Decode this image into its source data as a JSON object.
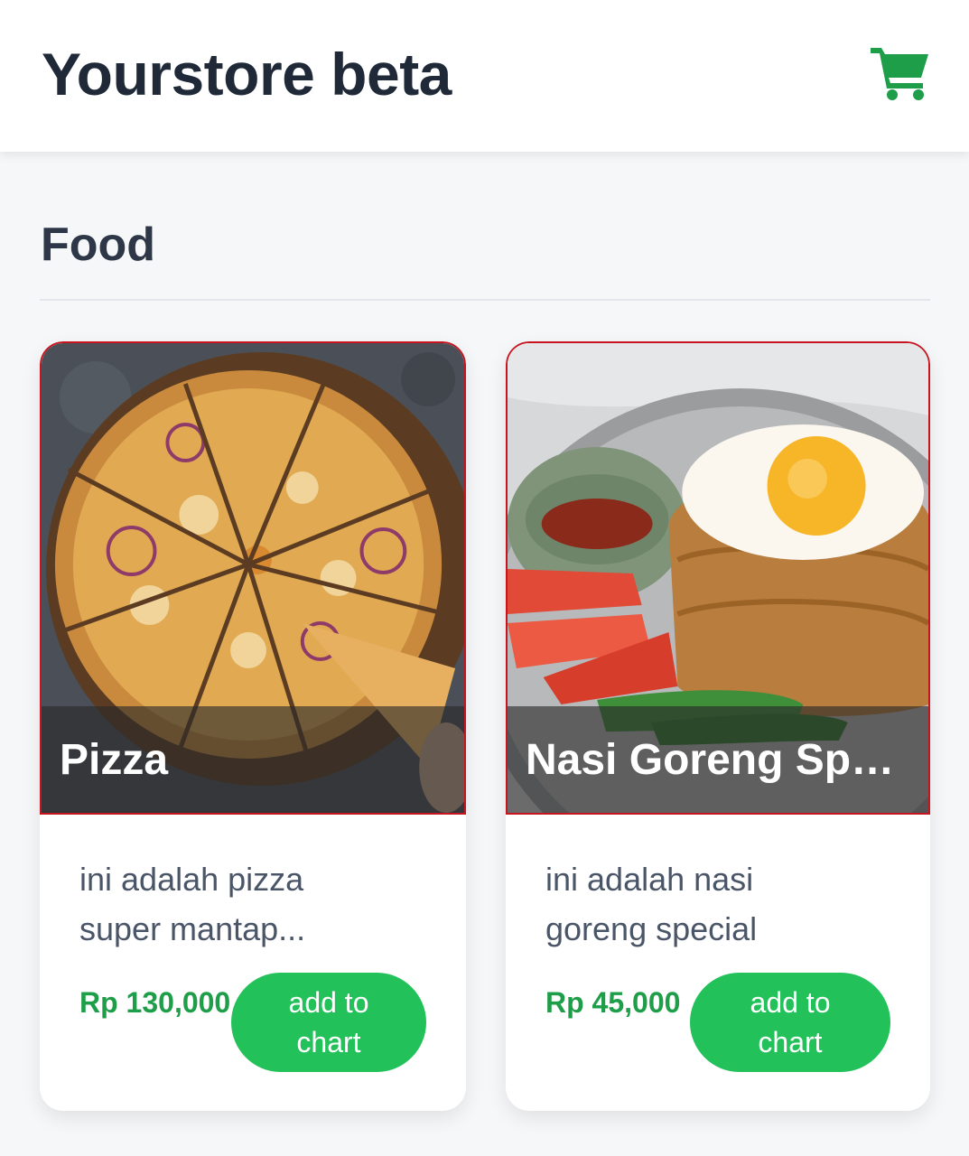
{
  "header": {
    "title": "Yourstore beta",
    "cart_icon": "shopping-cart-icon",
    "accent_color": "#1e9e49"
  },
  "section": {
    "title": "Food"
  },
  "products": [
    {
      "name": "Pizza",
      "description": "ini adalah pizza super mantap...",
      "price": "Rp 130,000",
      "button_label": "add to chart"
    },
    {
      "name": "Nasi Goreng Special",
      "description": "ini adalah nasi goreng special",
      "price": "Rp 45,000",
      "button_label": "add to chart"
    }
  ],
  "colors": {
    "button": "#22c15a",
    "price": "#1e9e49",
    "image_border": "#c8141e"
  }
}
